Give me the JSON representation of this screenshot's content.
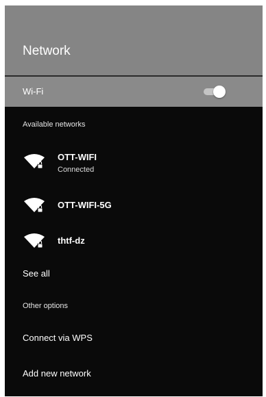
{
  "header": {
    "title": "Network"
  },
  "wifi": {
    "label": "Wi-Fi",
    "enabled": true
  },
  "available": {
    "label": "Available networks",
    "networks": [
      {
        "name": "OTT-WIFI",
        "status": "Connected",
        "icon": "wifi-locked-icon"
      },
      {
        "name": "OTT-WIFI-5G",
        "status": "",
        "icon": "wifi-locked-icon"
      },
      {
        "name": "thtf-dz",
        "status": "",
        "icon": "wifi-locked-icon"
      }
    ],
    "see_all": "See all"
  },
  "other": {
    "label": "Other options",
    "connect_wps": "Connect via WPS",
    "add_network": "Add new network"
  },
  "colors": {
    "header_bg": "#858585",
    "wifi_row_bg": "#8a8a8a",
    "body_bg": "#0a0a0a",
    "text": "#ffffff"
  }
}
